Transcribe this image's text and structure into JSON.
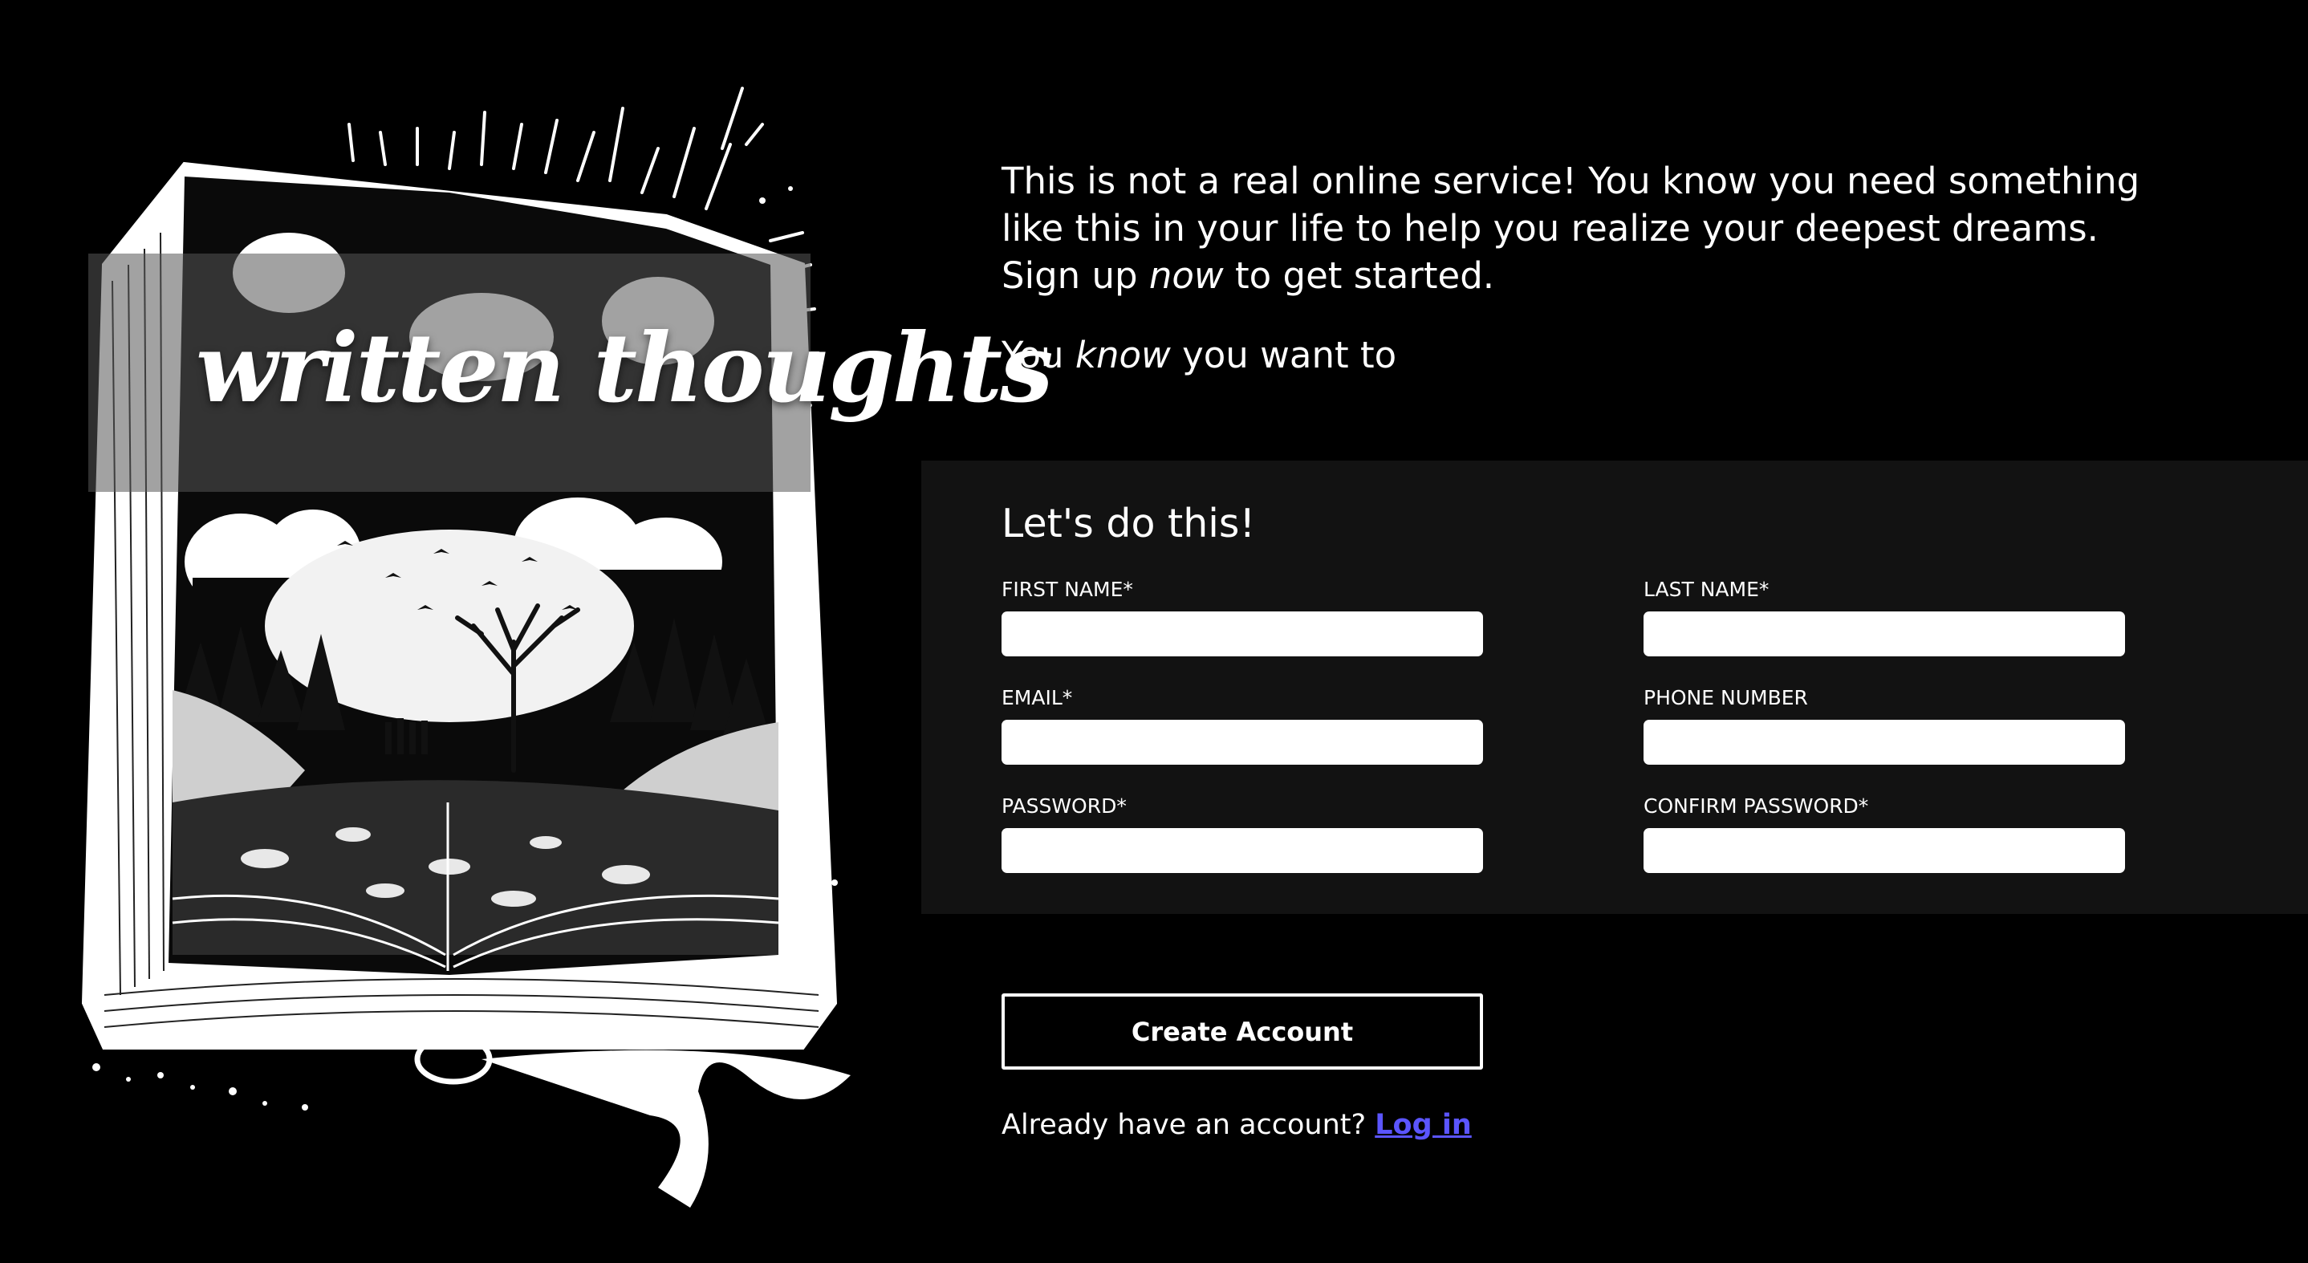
{
  "hero": {
    "brand_title": "written thoughts",
    "image_description_icon": "open-book-illustration-icon"
  },
  "intro": {
    "line1_before": "This is not a real online service! You know you need something like this in your life to help you realize your deepest dreams. Sign up",
    "line1_emph": "now",
    "line1_after": "to get started.",
    "line2_before": "You",
    "line2_emph": "know",
    "line2_after": "you want to"
  },
  "form": {
    "heading": "Let's do this!",
    "fields": [
      {
        "label": "FIRST NAME*",
        "value": "",
        "placeholder": ""
      },
      {
        "label": "LAST NAME*",
        "value": "",
        "placeholder": ""
      },
      {
        "label": "EMAIL*",
        "value": "",
        "placeholder": ""
      },
      {
        "label": "PHONE NUMBER",
        "value": "",
        "placeholder": ""
      },
      {
        "label": "PASSWORD*",
        "value": "",
        "placeholder": ""
      },
      {
        "label": "CONFIRM PASSWORD*",
        "value": "",
        "placeholder": ""
      }
    ],
    "submit_label": "Create Account"
  },
  "login": {
    "prompt": "Already have an account?",
    "link_label": "Log in"
  },
  "colors": {
    "background": "#000000",
    "form_band": "#121212",
    "link": "#5b55ff"
  }
}
